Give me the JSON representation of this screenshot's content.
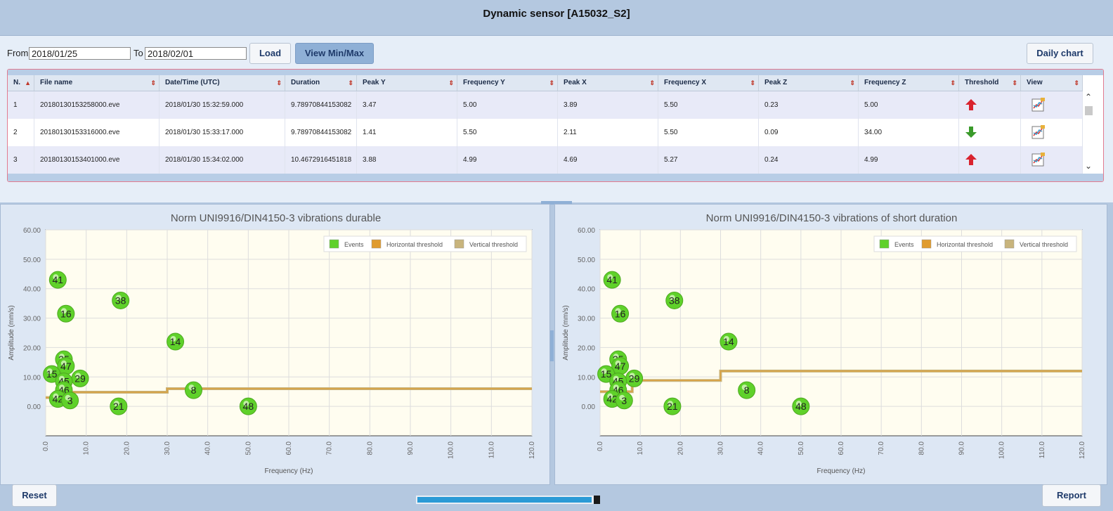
{
  "window": {
    "title": "Dynamic sensor [A15032_S2]"
  },
  "filters": {
    "from_label": "From",
    "from_value": "2018/01/25",
    "to_label": "To",
    "to_value": "2018/02/01",
    "load_label": "Load",
    "view_minmax_label": "View Min/Max",
    "daily_chart_label": "Daily chart"
  },
  "table": {
    "columns": [
      "N.",
      "File name",
      "Date/Time (UTC)",
      "Duration",
      "Peak Y",
      "Frequency Y",
      "Peak X",
      "Frequency X",
      "Peak Z",
      "Frequency Z",
      "Threshold",
      "View"
    ],
    "rows": [
      {
        "n": "1",
        "file": "20180130153258000.eve",
        "datetime": "2018/01/30 15:32:59.000",
        "duration": "9.78970844153082",
        "peak_y": "3.47",
        "freq_y": "5.00",
        "peak_x": "3.89",
        "freq_x": "5.50",
        "peak_z": "0.23",
        "freq_z": "5.00",
        "threshold": "up"
      },
      {
        "n": "2",
        "file": "20180130153316000.eve",
        "datetime": "2018/01/30 15:33:17.000",
        "duration": "9.78970844153082",
        "peak_y": "1.41",
        "freq_y": "5.50",
        "peak_x": "2.11",
        "freq_x": "5.50",
        "peak_z": "0.09",
        "freq_z": "34.00",
        "threshold": "down"
      },
      {
        "n": "3",
        "file": "20180130153401000.eve",
        "datetime": "2018/01/30 15:34:02.000",
        "duration": "10.4672916451818",
        "peak_y": "3.88",
        "freq_y": "4.99",
        "peak_x": "4.69",
        "freq_x": "5.27",
        "peak_z": "0.24",
        "freq_z": "4.99",
        "threshold": "up"
      }
    ]
  },
  "colors": {
    "events": "#5fd12a",
    "horizontal_threshold": "#e09b2d",
    "vertical_threshold": "#c8b47c",
    "plot_bg": "#fffdf0",
    "threshold_up": "#d9232e",
    "threshold_down": "#3a9a2a"
  },
  "chart_data": [
    {
      "type": "scatter",
      "title": "Norm UNI9916/DIN4150-3 vibrations durable",
      "xlabel": "Frequency (Hz)",
      "ylabel": "Amplitude (mm/s)",
      "xlim": [
        0,
        120
      ],
      "ylim": [
        -10,
        60
      ],
      "x_ticks": [
        "0.0",
        "10.0",
        "20.0",
        "30.0",
        "40.0",
        "50.0",
        "60.0",
        "70.0",
        "80.0",
        "90.0",
        "100.0",
        "110.0",
        "120.0"
      ],
      "y_ticks": [
        "60.00",
        "50.00",
        "40.00",
        "30.00",
        "20.00",
        "10.00",
        "0.00"
      ],
      "grid": true,
      "legend": [
        "Events",
        "Horizontal threshold",
        "Vertical threshold"
      ],
      "legend_position": "top-right",
      "events": [
        {
          "label": "41",
          "x": 3,
          "y": 43
        },
        {
          "label": "16",
          "x": 5,
          "y": 31.5
        },
        {
          "label": "38",
          "x": 18.5,
          "y": 36
        },
        {
          "label": "14",
          "x": 32,
          "y": 22
        },
        {
          "label": "25",
          "x": 4.5,
          "y": 16
        },
        {
          "label": "47",
          "x": 5,
          "y": 13.7
        },
        {
          "label": "15",
          "x": 1.5,
          "y": 11
        },
        {
          "label": "29",
          "x": 8.5,
          "y": 9.5
        },
        {
          "label": "45",
          "x": 4.5,
          "y": 8.5
        },
        {
          "label": "46",
          "x": 4.5,
          "y": 5.5
        },
        {
          "label": "42",
          "x": 3,
          "y": 2.5
        },
        {
          "label": "3",
          "x": 6,
          "y": 2
        },
        {
          "label": "8",
          "x": 36.5,
          "y": 5.5
        },
        {
          "label": "21",
          "x": 18,
          "y": 0
        },
        {
          "label": "48",
          "x": 50,
          "y": 0
        }
      ],
      "threshold": [
        [
          0,
          3
        ],
        [
          5,
          3
        ],
        [
          5,
          4.8
        ],
        [
          30,
          4.8
        ],
        [
          30,
          6
        ],
        [
          120,
          6
        ]
      ]
    },
    {
      "type": "scatter",
      "title": "Norm UNI9916/DIN4150-3 vibrations of short duration",
      "xlabel": "Frequency (Hz)",
      "ylabel": "Amplitude (mm/s)",
      "xlim": [
        0,
        120
      ],
      "ylim": [
        -10,
        60
      ],
      "x_ticks": [
        "0.0",
        "10.0",
        "20.0",
        "30.0",
        "40.0",
        "50.0",
        "60.0",
        "70.0",
        "80.0",
        "90.0",
        "100.0",
        "110.0",
        "120.0"
      ],
      "y_ticks": [
        "60.00",
        "50.00",
        "40.00",
        "30.00",
        "20.00",
        "10.00",
        "0.00"
      ],
      "grid": true,
      "legend": [
        "Events",
        "Horizontal threshold",
        "Vertical threshold"
      ],
      "legend_position": "top-right",
      "events": [
        {
          "label": "41",
          "x": 3,
          "y": 43
        },
        {
          "label": "16",
          "x": 5,
          "y": 31.5
        },
        {
          "label": "38",
          "x": 18.5,
          "y": 36
        },
        {
          "label": "14",
          "x": 32,
          "y": 22
        },
        {
          "label": "25",
          "x": 4.5,
          "y": 16
        },
        {
          "label": "47",
          "x": 5,
          "y": 13.7
        },
        {
          "label": "15",
          "x": 1.5,
          "y": 11
        },
        {
          "label": "29",
          "x": 8.5,
          "y": 9.5
        },
        {
          "label": "45",
          "x": 4.5,
          "y": 8.5
        },
        {
          "label": "46",
          "x": 4.5,
          "y": 5.5
        },
        {
          "label": "42",
          "x": 3,
          "y": 2.5
        },
        {
          "label": "3",
          "x": 6,
          "y": 2
        },
        {
          "label": "8",
          "x": 36.5,
          "y": 5.5
        },
        {
          "label": "21",
          "x": 18,
          "y": 0
        },
        {
          "label": "48",
          "x": 50,
          "y": 0
        }
      ],
      "threshold": [
        [
          0,
          5
        ],
        [
          8,
          5
        ],
        [
          8,
          8.8
        ],
        [
          30,
          8.8
        ],
        [
          30,
          12
        ],
        [
          120,
          12
        ]
      ]
    }
  ],
  "footer": {
    "reset_label": "Reset",
    "report_label": "Report",
    "progress": 0.99
  }
}
